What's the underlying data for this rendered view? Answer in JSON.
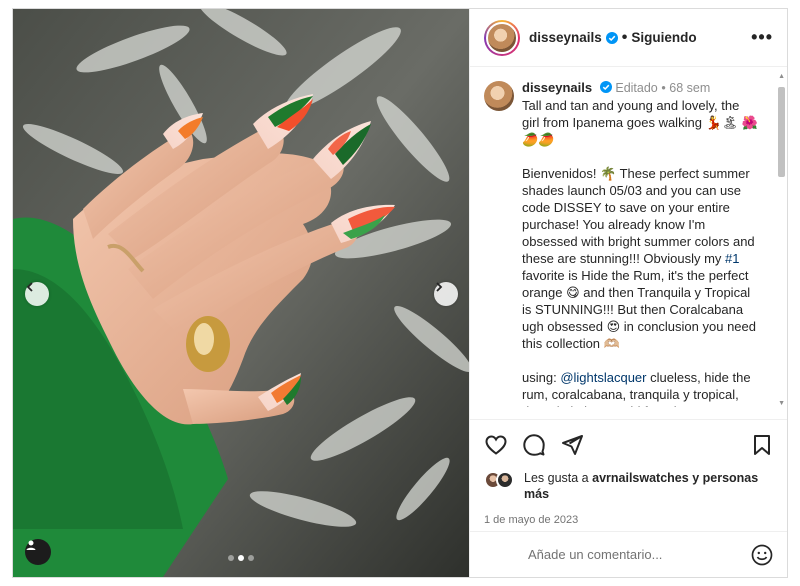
{
  "post": {
    "username": "disseynails",
    "following_label": "Siguiendo",
    "more_label": "•••"
  },
  "caption": {
    "username": "disseynails",
    "edited_label": "Editado",
    "age": "68 sem",
    "line1": "Tall and tan and young and lovely, the girl from Ipanema goes walking 💃🏝",
    "line1_emojis": "🌺🥭🥭",
    "para2_a": "Bienvenidos! 🌴 These perfect summer shades launch 05/03 and you can use code DISSEY to save on your entire purchase! You already know I'm obsessed with bright summer colors and these are stunning!!! Obviously my ",
    "para2_tag": "#1",
    "para2_b": " favorite is Hide the Rum, it's the perfect orange 😋 and then Tranquila y Tropical is STUNNING!!! But then Coralcabana ugh obsessed 😍 in conclusion you need this collection 🫶🏼",
    "para3_a": "using: ",
    "para3_mention": "@lightslacquer",
    "para3_b": " clueless, hide the rum, coralcabana, tranquila y tropical, down in kokomo, girl from ipanema &"
  },
  "likes": {
    "prefix": "Les gusta a",
    "user": "avrnailswatches",
    "suffix": "y personas más"
  },
  "date": "1 de mayo de 2023",
  "comment": {
    "placeholder": "Añade un comentario..."
  },
  "icons": {
    "like": "heart-icon",
    "comment": "comment-icon",
    "share": "paper-plane-icon",
    "save": "bookmark-icon",
    "emoji": "smiley-icon",
    "prev": "chevron-left-icon",
    "next": "chevron-right-icon",
    "tagged": "user-tag-icon"
  },
  "carousel": {
    "slides": 3,
    "active": 2
  },
  "colors": {
    "verified": "#0095f6",
    "text": "#262626",
    "muted": "#8e8e8e",
    "link": "#00376b"
  }
}
